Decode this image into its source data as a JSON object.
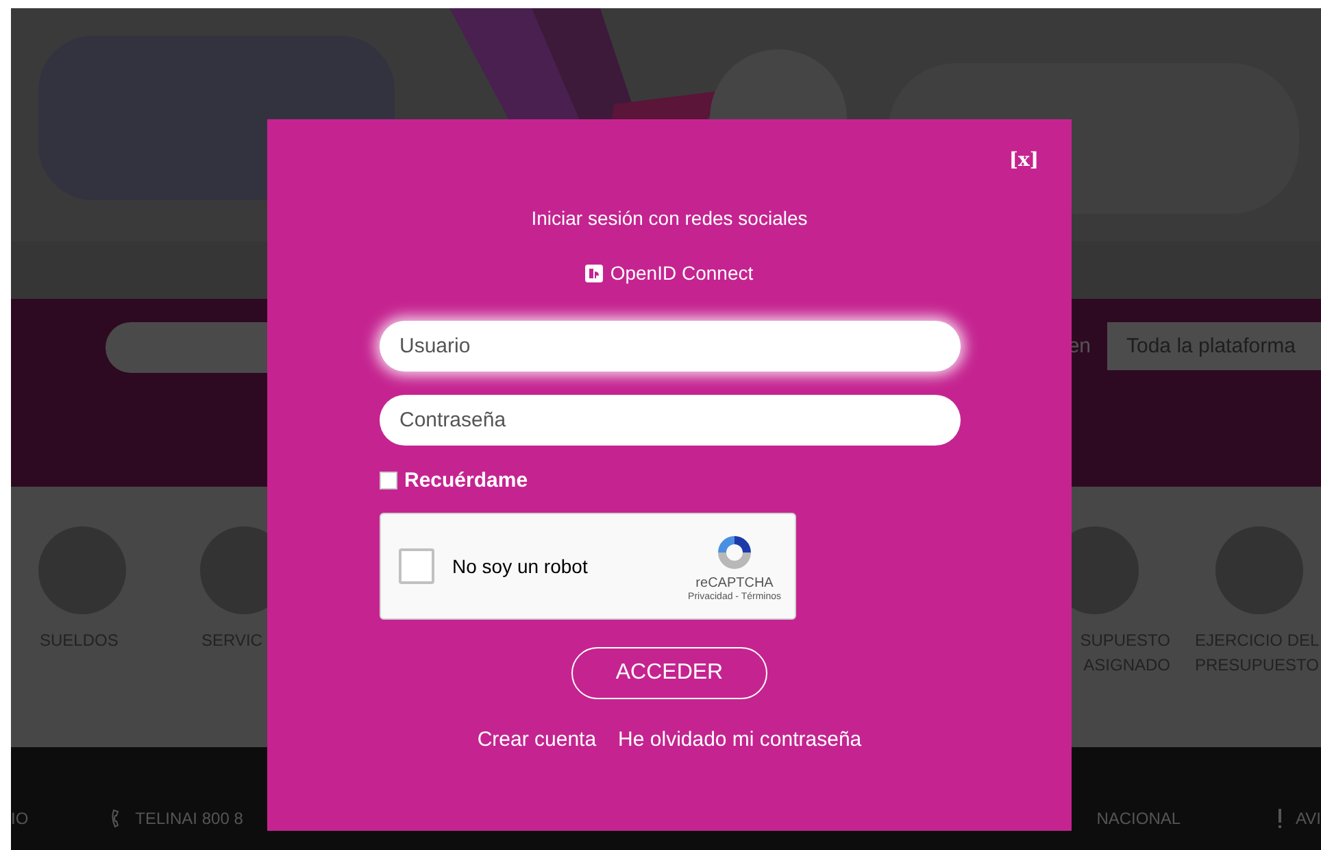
{
  "background": {
    "search": {
      "scope_label": "en",
      "scope_value": "Toda la plataforma"
    },
    "categories_left": [
      {
        "lines": [
          "SUELDOS"
        ]
      },
      {
        "lines": [
          "SERVIC"
        ]
      }
    ],
    "categories_right": [
      {
        "lines": [
          "SUPUESTO",
          "ASIGNADO"
        ]
      },
      {
        "lines": [
          "EJERCICIO DEL",
          "PRESUPUESTO"
        ]
      }
    ],
    "footer_left": [
      {
        "kind": "text",
        "label": "IO"
      },
      {
        "kind": "phone",
        "label": "TELINAI 800 8"
      }
    ],
    "footer_right": [
      {
        "kind": "text",
        "label": "NACIONAL"
      },
      {
        "kind": "alert",
        "label": "AVI"
      }
    ]
  },
  "modal": {
    "close": "[x]",
    "social_title": "Iniciar sesión con redes sociales",
    "openid": "OpenID Connect",
    "fields": [
      {
        "placeholder": "Usuario",
        "focused": true
      },
      {
        "placeholder": "Contraseña",
        "focused": false
      }
    ],
    "remember": {
      "label": "Recuérdame",
      "checked": false
    },
    "captcha": {
      "label": "No soy un robot",
      "checked": false,
      "brand": "reCAPTCHA",
      "links": "Privacidad - Términos"
    },
    "submit": "ACCEDER",
    "links": [
      "Crear cuenta",
      "He olvidado mi contraseña"
    ]
  }
}
